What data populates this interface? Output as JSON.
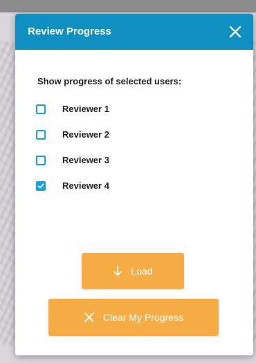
{
  "modal": {
    "title": "Review Progress",
    "prompt": "Show progress of selected users:",
    "options": [
      {
        "label": "Reviewer 1",
        "checked": false
      },
      {
        "label": "Reviewer 2",
        "checked": false
      },
      {
        "label": "Reviewer 3",
        "checked": false
      },
      {
        "label": "Reviewer 4",
        "checked": true
      }
    ],
    "load_label": "Load",
    "clear_label": "Clear My Progress"
  },
  "colors": {
    "header": "#0e8fbf",
    "checkbox": "#1aa0dc",
    "button": "#f6ad45"
  },
  "icons": {
    "close": "close-icon",
    "load": "arrow-down-icon",
    "clear": "close-icon"
  }
}
